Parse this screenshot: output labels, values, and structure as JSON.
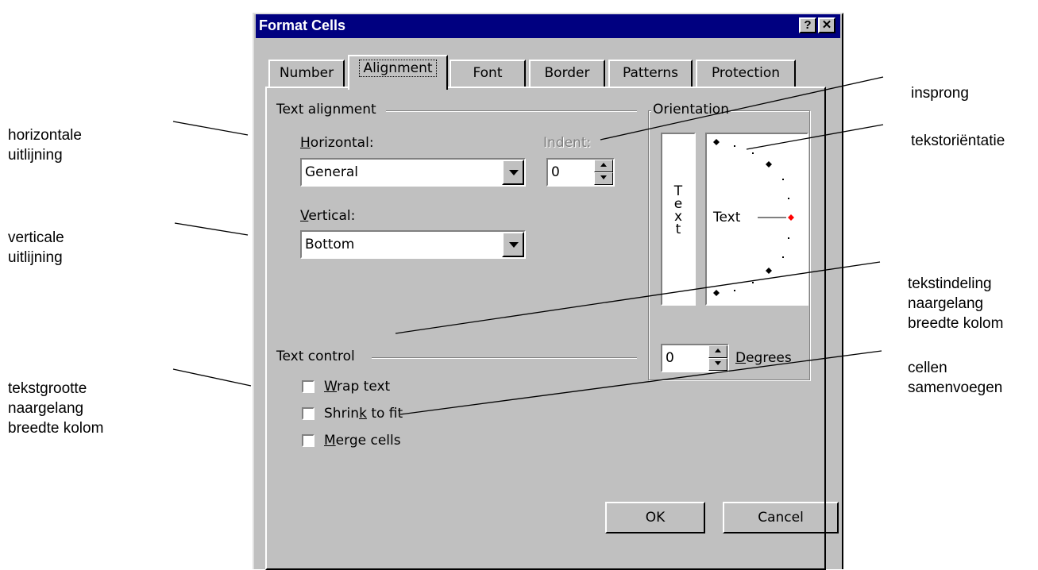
{
  "dialog": {
    "title": "Format Cells",
    "help_button": "?",
    "close_button": "✕",
    "tabs": [
      "Number",
      "Alignment",
      "Font",
      "Border",
      "Patterns",
      "Protection"
    ],
    "active_tab": "Alignment"
  },
  "text_alignment": {
    "group_label": "Text alignment",
    "horizontal_label": "Horizontal:",
    "horizontal_value": "General",
    "indent_label": "Indent:",
    "indent_value": "0",
    "vertical_label": "Vertical:",
    "vertical_value": "Bottom"
  },
  "orientation": {
    "group_label": "Orientation",
    "vertical_text": "Text",
    "dial_text": "Text",
    "degrees_value": "0",
    "degrees_label": "Degrees"
  },
  "text_control": {
    "group_label": "Text control",
    "wrap_text": "Wrap text",
    "shrink_to_fit": "Shrink to fit",
    "merge_cells": "Merge cells",
    "wrap_checked": false,
    "shrink_checked": false,
    "merge_checked": false
  },
  "buttons": {
    "ok": "OK",
    "cancel": "Cancel"
  },
  "annotations": {
    "left": [
      "horizontale\nuitlijning",
      "verticale\nuitlijning",
      "tekstgrootte\nnaargelang\nbreedte kolom"
    ],
    "right": [
      "insprong",
      "tekstoriëntatie",
      "tekstindeling\nnaargelang\nbreedte kolom",
      "cellen\nsamenvoegen"
    ]
  },
  "colors": {
    "titlebar": "#000080",
    "dialog_face": "#c0c0c0",
    "dial_marker_active": "#ff0000"
  }
}
